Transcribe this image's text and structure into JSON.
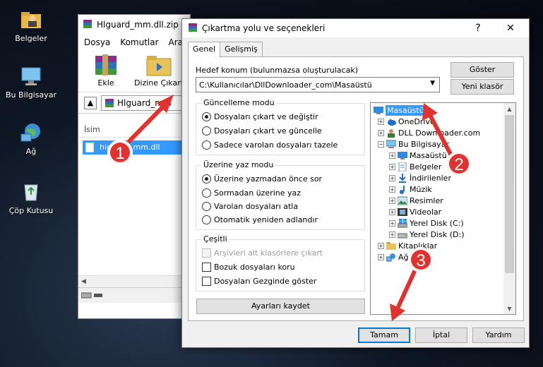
{
  "desktop": {
    "icons": [
      {
        "label": "Belgeler"
      },
      {
        "label": "Bu Bilgisayar"
      },
      {
        "label": "Ağ"
      },
      {
        "label": "Çöp Kutusu"
      }
    ]
  },
  "bg_window": {
    "title": "Hlguard_mm.dll.zip",
    "menu": [
      "Dosya",
      "Komutlar",
      "Araçla"
    ],
    "toolbar": {
      "extract_label": "Ekle",
      "extract_to_label": "Dizine Çıkart"
    },
    "address": "Hlguard_mm",
    "column_name": "İsim",
    "file": "hlguard_mm.dll"
  },
  "dialog": {
    "title": "Çıkartma yolu ve seçenekleri",
    "help": "?",
    "close": "✕",
    "tabs": [
      "Genel",
      "Gelişmiş"
    ],
    "destination_label": "Hedef konum (bulunmazsa oluşturulacak)",
    "destination_value": "C:\\Kullanıcılar\\DllDownloader_com\\Masaüstü",
    "show_button": "Göster",
    "new_folder_button": "Yeni klasör",
    "update_mode": {
      "label": "Güncelleme modu",
      "options": [
        "Dosyaları çıkart ve değiştir",
        "Dosyaları çıkart ve güncelle",
        "Sadece varolan dosyaları tazele"
      ],
      "selected": 0
    },
    "overwrite_mode": {
      "label": "Üzerine yaz modu",
      "options": [
        "Üzerine yazmadan önce sor",
        "Sormadan üzerine yaz",
        "Varolan dosyaları atla",
        "Otomatik yeniden adlandır"
      ],
      "selected": 0
    },
    "misc": {
      "label": "Çeşitli",
      "options": [
        "Arşivleri alt klasörlere çıkart",
        "Bozuk dosyaları koru",
        "Dosyaları Gezginde göster"
      ]
    },
    "save_settings": "Ayarları kaydet",
    "tree": [
      {
        "label": "Masaüstü",
        "selected": true
      },
      {
        "label": "OneDrive"
      },
      {
        "label": "DLL Downloader.com"
      },
      {
        "label": "Bu Bilgisayar"
      },
      {
        "label": "Masaüstü"
      },
      {
        "label": "Belgeler"
      },
      {
        "label": "İndirilenler"
      },
      {
        "label": "Müzik"
      },
      {
        "label": "Resimler"
      },
      {
        "label": "Videolar"
      },
      {
        "label": "Yerel Disk (C:)"
      },
      {
        "label": "Yerel Disk (D:)"
      },
      {
        "label": "Kitaplıklar"
      },
      {
        "label": "Ağ"
      }
    ],
    "ok": "Tamam",
    "cancel": "İptal",
    "help_button": "Yardım"
  },
  "annotations": [
    "1",
    "2",
    "3"
  ],
  "colors": {
    "annotation": "#e0322e",
    "selection": "#3399ff",
    "accent": "#0078d7"
  }
}
